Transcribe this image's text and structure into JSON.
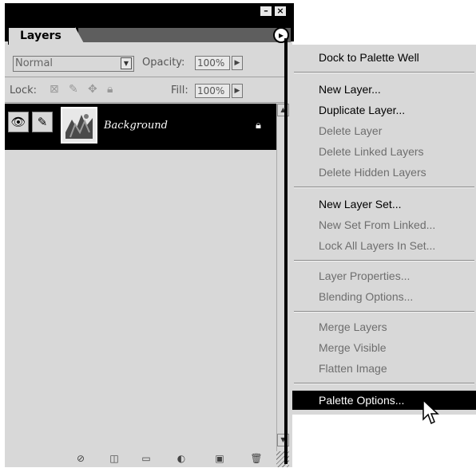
{
  "palette": {
    "tab_label": "Layers",
    "blend_mode": "Normal",
    "opacity_label": "Opacity:",
    "opacity_value": "100%",
    "lock_label": "Lock:",
    "fill_label": "Fill:",
    "fill_value": "100%",
    "layer": {
      "name": "Background"
    }
  },
  "menu": {
    "items": [
      {
        "label": "Dock to Palette Well",
        "state": "enabled"
      },
      {
        "label": "New Layer...",
        "state": "enabled"
      },
      {
        "label": "Duplicate Layer...",
        "state": "enabled"
      },
      {
        "label": "Delete Layer",
        "state": "disabled"
      },
      {
        "label": "Delete Linked Layers",
        "state": "disabled"
      },
      {
        "label": "Delete Hidden Layers",
        "state": "disabled"
      },
      {
        "label": "New Layer Set...",
        "state": "enabled"
      },
      {
        "label": "New Set From Linked...",
        "state": "disabled"
      },
      {
        "label": "Lock All Layers In Set...",
        "state": "disabled"
      },
      {
        "label": "Layer Properties...",
        "state": "disabled"
      },
      {
        "label": "Blending Options...",
        "state": "disabled"
      },
      {
        "label": "Merge Layers",
        "state": "disabled"
      },
      {
        "label": "Merge Visible",
        "state": "disabled"
      },
      {
        "label": "Flatten Image",
        "state": "disabled"
      },
      {
        "label": "Palette Options...",
        "state": "highlighted"
      }
    ]
  },
  "icons": {
    "minimize": "minimize-icon",
    "close": "close-icon",
    "palette_menu": "palette-menu-arrow-icon"
  },
  "colors": {
    "panel_bg": "#d8d8d8",
    "highlight": "#000000",
    "disabled_text": "#6e6e6e"
  }
}
